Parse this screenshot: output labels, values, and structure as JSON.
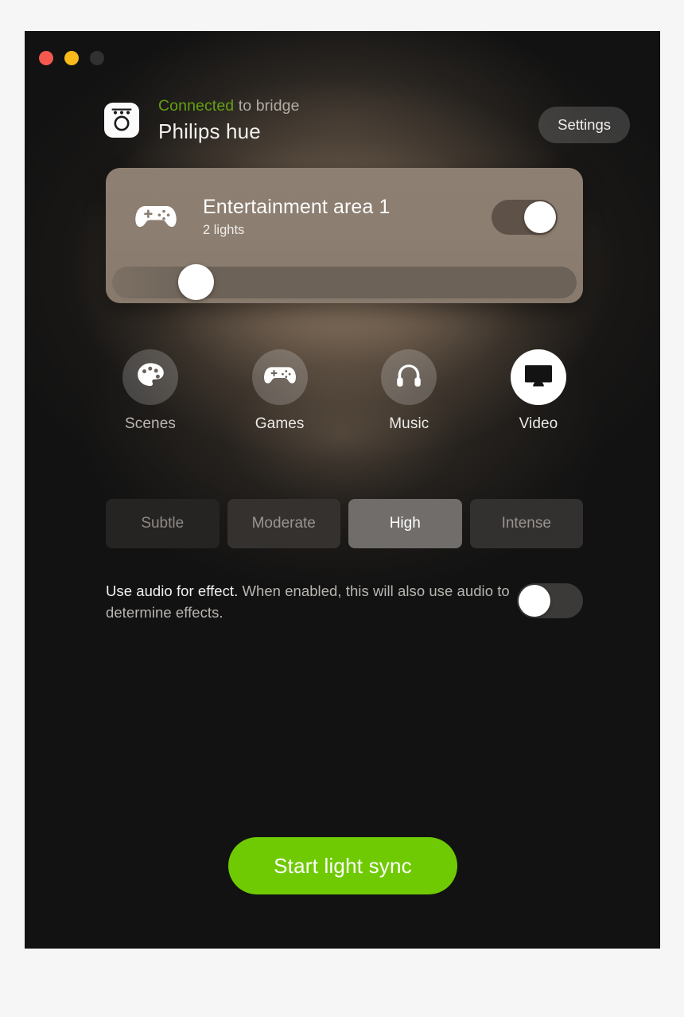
{
  "window": {
    "traffic_lights": [
      {
        "name": "close",
        "color": "#f4584f"
      },
      {
        "name": "minimize",
        "color": "#f9ba1a"
      },
      {
        "name": "zoom",
        "color": "#33312f"
      }
    ]
  },
  "header": {
    "logo_icon": "philips-hue-logo-icon",
    "status_connected": "Connected",
    "status_rest": " to bridge",
    "brand": "Philips hue",
    "settings_label": "Settings",
    "connected_color": "#64a013"
  },
  "entertainment": {
    "icon": "gamepad-icon",
    "title": "Entertainment area 1",
    "subtitle": "2 lights",
    "power_on": true,
    "brightness_percent": 19,
    "card_color": "#8c7e70"
  },
  "modes": [
    {
      "id": "scenes",
      "label": "Scenes",
      "icon": "palette-icon",
      "selected": false,
      "dim": true
    },
    {
      "id": "games",
      "label": "Games",
      "icon": "gamepad-icon",
      "selected": false,
      "dim": false
    },
    {
      "id": "music",
      "label": "Music",
      "icon": "headphones-icon",
      "selected": false,
      "dim": false
    },
    {
      "id": "video",
      "label": "Video",
      "icon": "monitor-icon",
      "selected": true,
      "dim": false
    }
  ],
  "intensity": {
    "options": [
      {
        "label": "Subtle",
        "selected": false
      },
      {
        "label": "Moderate",
        "selected": false
      },
      {
        "label": "High",
        "selected": true
      },
      {
        "label": "Intense",
        "selected": false
      }
    ]
  },
  "audio": {
    "label_bold": "Use audio for effect.",
    "label_rest": " When enabled, this will also use audio to determine effects.",
    "enabled": false
  },
  "footer": {
    "start_label": "Start light sync",
    "start_color": "#6fca04"
  }
}
